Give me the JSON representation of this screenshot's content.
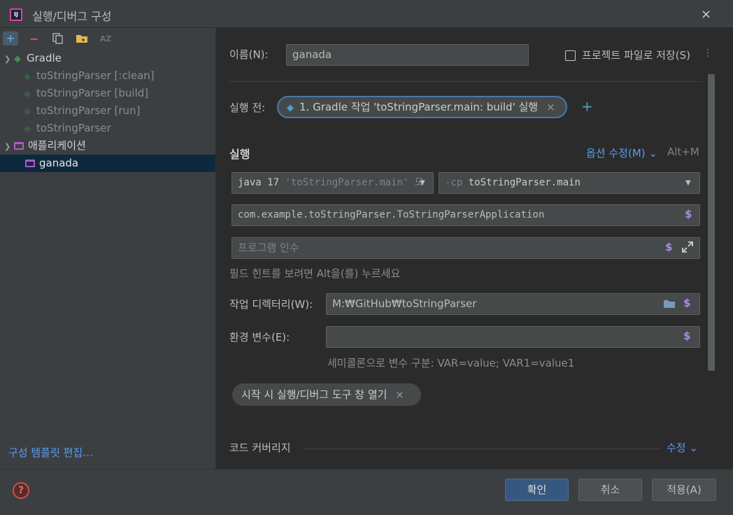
{
  "window": {
    "title": "실행/디버그 구성",
    "close_icon": "×"
  },
  "toolbar": {
    "add": "+",
    "remove": "−",
    "sort_label": "AZ"
  },
  "tree": {
    "gradle": {
      "label": "Gradle",
      "children": [
        "toString​Parser [:clean]",
        "toStringParser [build]",
        "toStringParser [run]",
        "toStringParser"
      ]
    },
    "application": {
      "label": "애플리케이션",
      "children": [
        "ganada"
      ]
    }
  },
  "edit_templates": "구성 템플릿 편집…",
  "form": {
    "name_label": "이름(N):",
    "name_value": "ganada",
    "store_as_file": "프로젝트 파일로 저장(S)",
    "before_launch_label": "실행 전:",
    "before_launch_task": "1. Gradle 작업 'toStringParser.main: build' 실행",
    "run_section": "실행",
    "modify_options": "옵션 수정(M)",
    "modify_shortcut": "Alt+M",
    "jdk_prefix": "java 17",
    "jdk_module": "'toStringParser.main' 모",
    "cp_flag": "-cp",
    "cp_value": "toStringParser.main",
    "main_class": "com.example.toStringParser.ToStringParserApplication",
    "program_args_placeholder": "프로그램 인수",
    "field_hint": "필드 힌트를 보려면 Alt을(를) 누르세요",
    "workdir_label": "작업 디렉터리(W):",
    "workdir_value": "M:₩GitHub₩toStringParser",
    "env_label": "환경 변수(E):",
    "env_hint": "세미콜론으로 변수 구분: VAR=value; VAR1=value1",
    "open_tool_chip": "시작 시 실행/디버그 도구 창 열기",
    "coverage_label": "코드 커버리지",
    "coverage_modify": "수정"
  },
  "buttons": {
    "ok": "확인",
    "cancel": "취소",
    "apply": "적용(A)"
  },
  "colors": {
    "accent": "#589df6",
    "primary_button": "#365880",
    "macro": "#a98de4"
  }
}
